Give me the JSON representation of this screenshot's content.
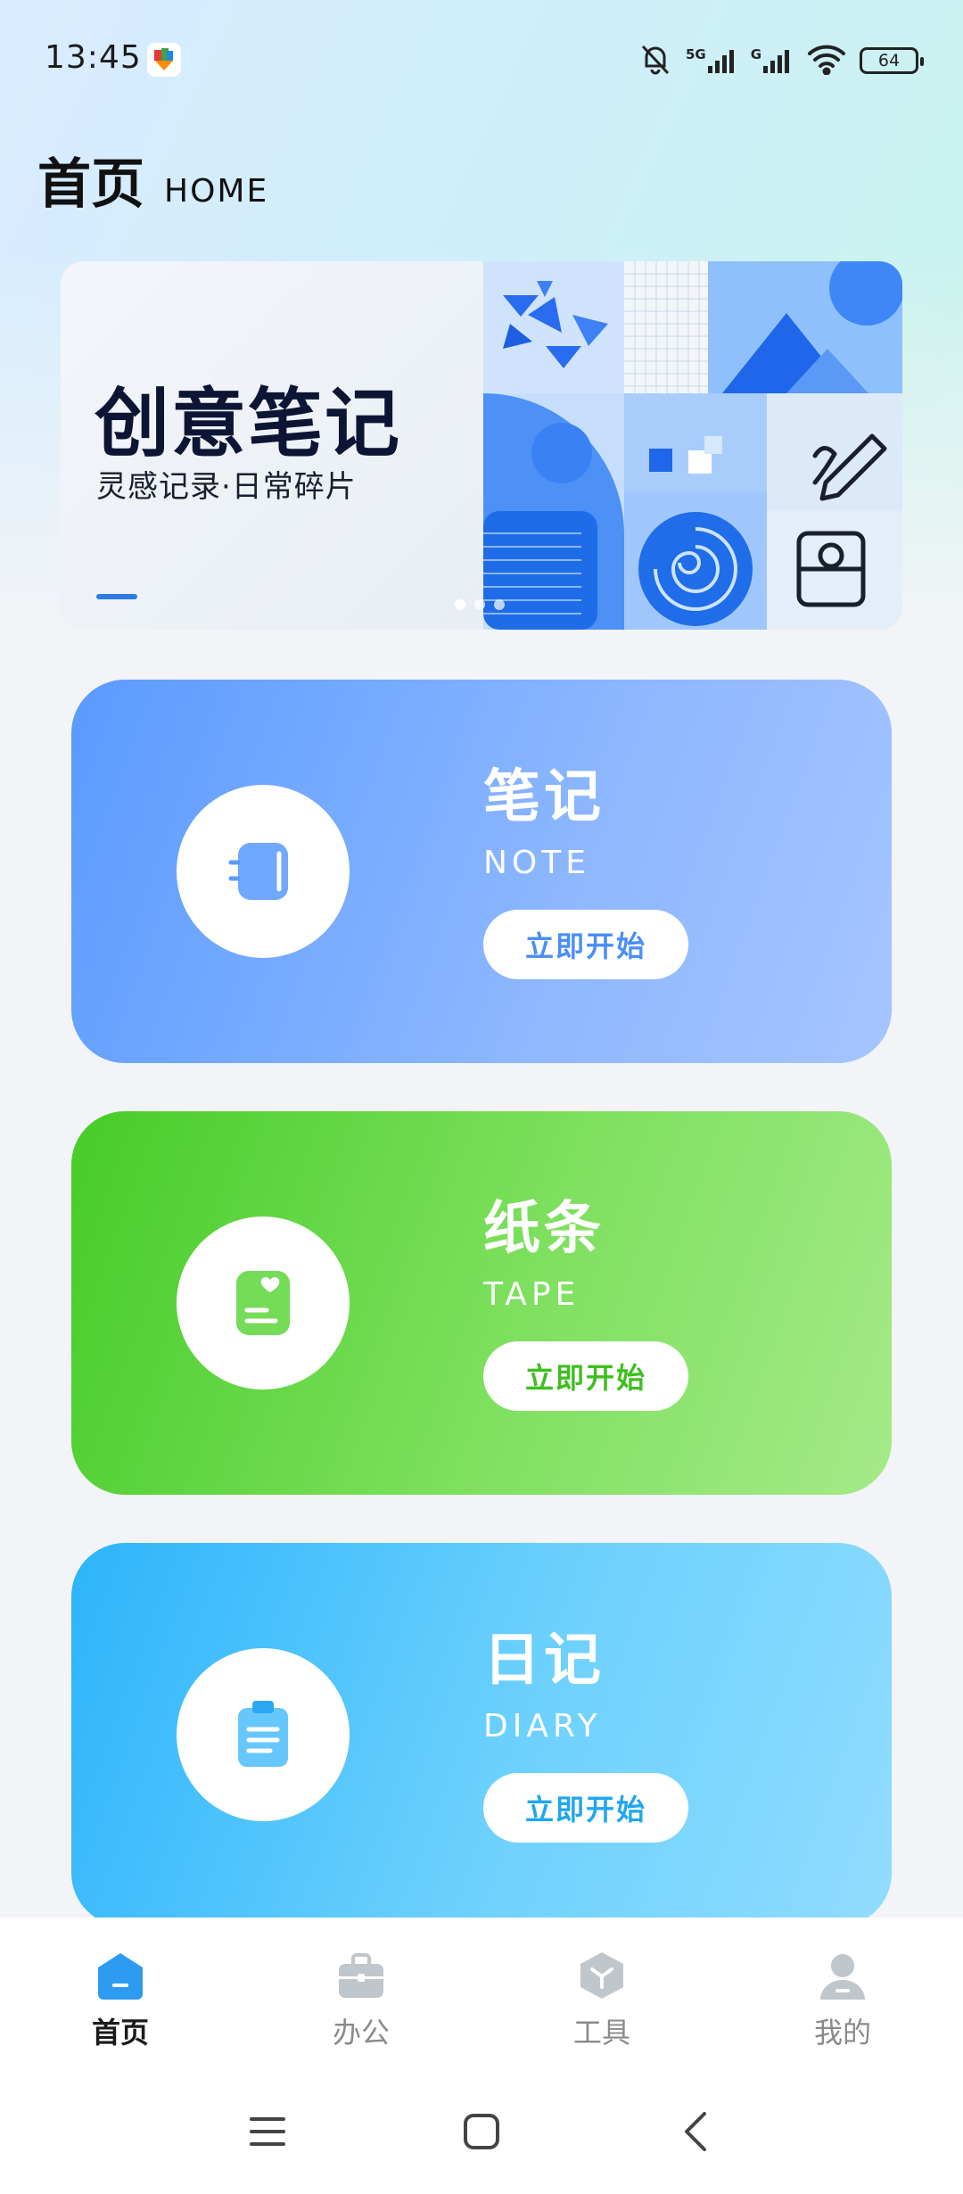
{
  "status": {
    "time": "13:45",
    "network_5g": "5G",
    "network_g": "G",
    "battery": "64"
  },
  "header": {
    "title": "首页",
    "subtitle": "HOME"
  },
  "banner": {
    "title": "创意笔记",
    "subtitle": "灵感记录·日常碎片",
    "active_slide": 1,
    "slide_count": 3
  },
  "cards": [
    {
      "title": "笔记",
      "en": "NOTE",
      "button": "立即开始",
      "icon": "note-icon",
      "color": "#5a9bff"
    },
    {
      "title": "纸条",
      "en": "TAPE",
      "button": "立即开始",
      "icon": "tape-icon",
      "color": "#47cc28"
    },
    {
      "title": "日记",
      "en": "DIARY",
      "button": "立即开始",
      "icon": "diary-icon",
      "color": "#2db4fb"
    }
  ],
  "nav": [
    {
      "label": "首页",
      "icon": "home-icon",
      "active": true
    },
    {
      "label": "办公",
      "icon": "briefcase-icon",
      "active": false
    },
    {
      "label": "工具",
      "icon": "toolbox-icon",
      "active": false
    },
    {
      "label": "我的",
      "icon": "profile-icon",
      "active": false
    }
  ],
  "colors": {
    "accent": "#2d9bf0",
    "nav_inactive": "#bfc6cc"
  }
}
